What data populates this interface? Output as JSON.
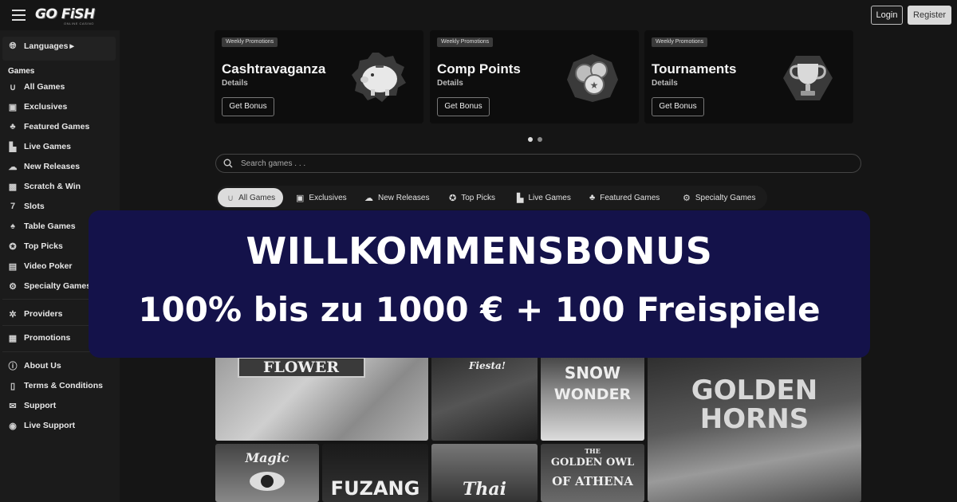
{
  "header": {
    "logo_text": "GO FiSH",
    "logo_sub": "ONLINE CASINO",
    "login_label": "Login",
    "register_label": "Register"
  },
  "sidebar": {
    "languages_label": "Languages",
    "languages_arrow": "▸",
    "games_heading": "Games",
    "items": [
      {
        "label": "All Games",
        "icon": "horseshoe-icon"
      },
      {
        "label": "Exclusives",
        "icon": "exclusive-icon"
      },
      {
        "label": "Featured Games",
        "icon": "clover-icon"
      },
      {
        "label": "Live Games",
        "icon": "live-icon"
      },
      {
        "label": "New Releases",
        "icon": "cloud-icon"
      },
      {
        "label": "Scratch & Win",
        "icon": "scratch-icon"
      },
      {
        "label": "Slots",
        "icon": "seven-icon"
      },
      {
        "label": "Table Games",
        "icon": "cards-icon"
      },
      {
        "label": "Top Picks",
        "icon": "badge-icon"
      },
      {
        "label": "Video Poker",
        "icon": "poker-icon"
      },
      {
        "label": "Specialty Games",
        "icon": "gear-icon"
      }
    ],
    "providers_label": "Providers",
    "promotions_label": "Promotions",
    "footer_items": [
      {
        "label": "About Us",
        "icon": "info-icon"
      },
      {
        "label": "Terms & Conditions",
        "icon": "document-icon"
      },
      {
        "label": "Support",
        "icon": "mail-icon"
      },
      {
        "label": "Live Support",
        "icon": "chat-icon"
      }
    ]
  },
  "promos": [
    {
      "tag": "Weekly Promotions",
      "title": "Cashtravaganza",
      "details": "Details",
      "button": "Get Bonus",
      "icon": "piggy-bank-icon"
    },
    {
      "tag": "Weekly Promotions",
      "title": "Comp Points",
      "details": "Details",
      "button": "Get Bonus",
      "icon": "coins-icon"
    },
    {
      "tag": "Weekly Promotions",
      "title": "Tournaments",
      "details": "Details",
      "button": "Get Bonus",
      "icon": "trophy-icon"
    }
  ],
  "search": {
    "placeholder": "Search games . . ."
  },
  "tabs": [
    {
      "label": "All Games",
      "active": true
    },
    {
      "label": "Exclusives",
      "active": false
    },
    {
      "label": "New Releases",
      "active": false
    },
    {
      "label": "Top Picks",
      "active": false
    },
    {
      "label": "Live Games",
      "active": false
    },
    {
      "label": "Featured Games",
      "active": false
    },
    {
      "label": "Specialty Games",
      "active": false
    }
  ],
  "games": {
    "flower": "FLOWER",
    "fiesta": "Fiesta!",
    "snow_wonder_1": "SNOW",
    "snow_wonder_2": "WONDER",
    "golden_horns_1": "GOLDEN",
    "golden_horns_2": "HORNS",
    "magic": "Magic",
    "fuzang": "FUZANG",
    "thai": "Thai",
    "owl_1": "THE",
    "owl_2": "GOLDEN OWL",
    "owl_3": "OF ATHENA"
  },
  "banner": {
    "title": "WILLKOMMENSBONUS",
    "subtitle": "100% bis zu 1000 € + 100 Freispiele",
    "background": "#14124a"
  }
}
